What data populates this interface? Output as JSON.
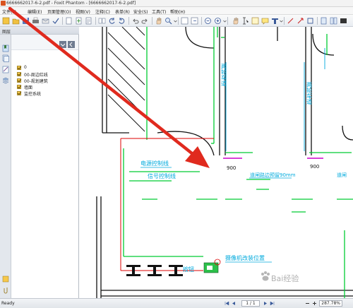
{
  "window": {
    "title": "6666662017-6-2.pdf - Foxit Phantom - [6666662017-6-2.pdf]"
  },
  "menu": [
    {
      "label": "文件(F)"
    },
    {
      "label": "编辑(E)"
    },
    {
      "label": "页面管理(O)"
    },
    {
      "label": "视图(V)"
    },
    {
      "label": "注释(C)"
    },
    {
      "label": "表单(R)"
    },
    {
      "label": "安全(S)"
    },
    {
      "label": "工具(T)"
    },
    {
      "label": "帮助(H)"
    }
  ],
  "panel": {
    "title": "图层",
    "layers": [
      {
        "name": "0",
        "checked": true
      },
      {
        "name": "00-周边红线",
        "checked": true
      },
      {
        "name": "00-规划建筑",
        "checked": true
      },
      {
        "name": "墙面",
        "checked": true
      },
      {
        "name": "监控系统",
        "checked": true
      }
    ]
  },
  "drawing": {
    "labels": {
      "lane_left": "两轮车道",
      "lane_right": "两轮车道",
      "dim_a": "900",
      "dim_b": "900",
      "reserve_a": "道闸路边预留90mm",
      "reserve_b": "道闸",
      "power_line": "电源控制线",
      "signal_line": "信号控制线",
      "button": "按钮",
      "camera": "摄像机改装位置"
    },
    "colors": {
      "line": "#00cc33",
      "cyan_text": "#00aadd",
      "red": "#dd0000",
      "magenta": "#cc00cc",
      "annotation_arrow": "#e02a1e"
    }
  },
  "status": {
    "state": "Ready",
    "page_display": "1 / 1",
    "zoom": "287.78%"
  },
  "watermark": {
    "text": "Bai经验"
  }
}
